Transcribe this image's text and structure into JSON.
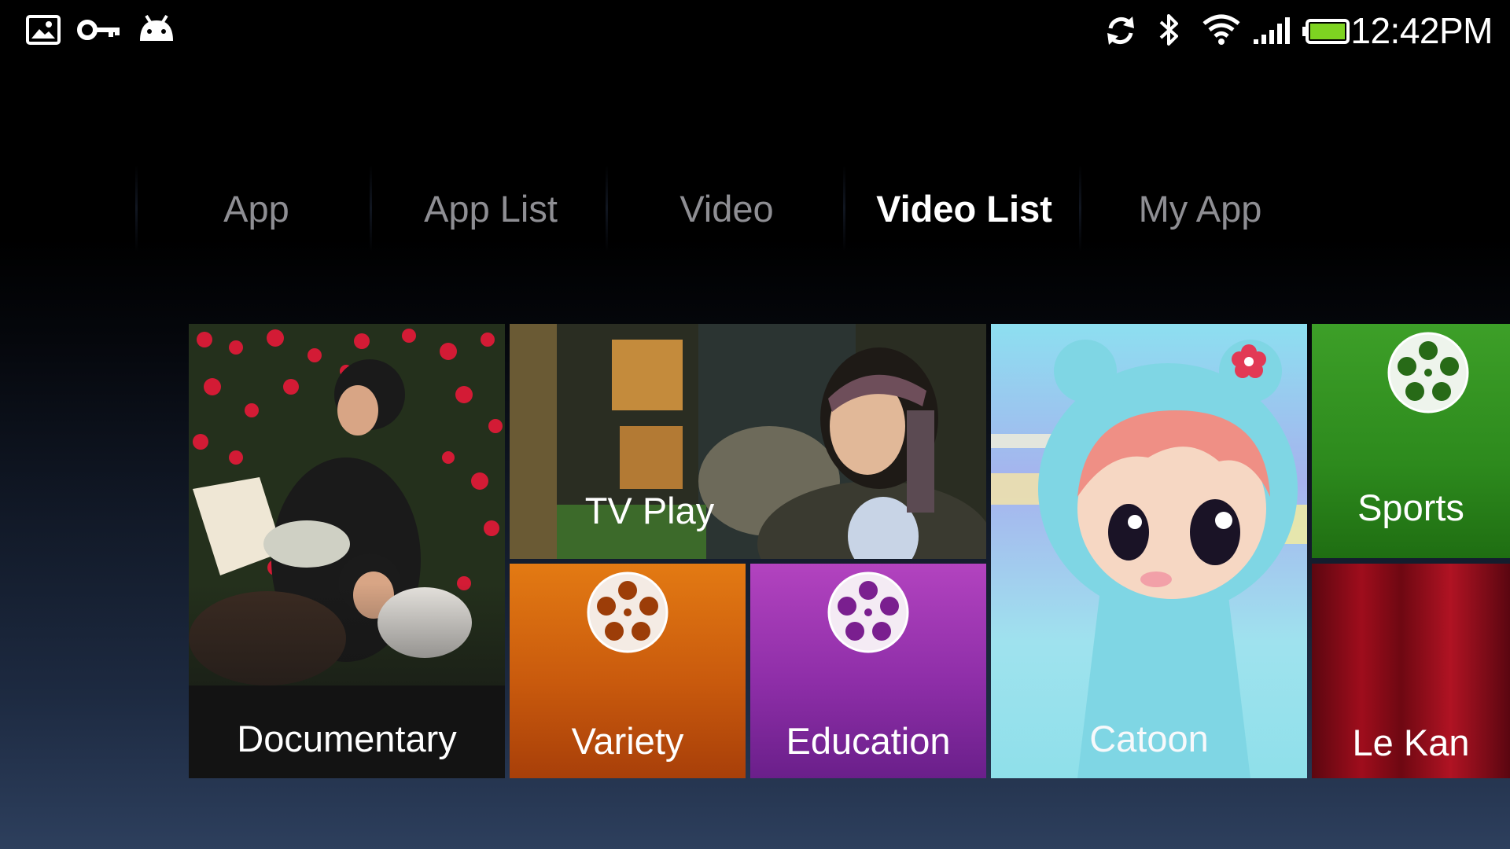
{
  "status_bar": {
    "left_icons": [
      "gallery-icon",
      "vpn-key-icon",
      "android-debug-icon"
    ],
    "right_icons": [
      "sync-icon",
      "bluetooth-icon",
      "wifi-icon",
      "signal-icon",
      "battery-icon"
    ],
    "time": "12:42PM",
    "battery_color": "#7ed321"
  },
  "tabs": [
    {
      "label": "App",
      "active": false
    },
    {
      "label": "App List",
      "active": false
    },
    {
      "label": "Video",
      "active": false
    },
    {
      "label": "Video List",
      "active": true
    },
    {
      "label": "My App",
      "active": false
    }
  ],
  "tiles": {
    "documentary": {
      "label": "Documentary",
      "icon": "photo-thumbnail"
    },
    "tvplay": {
      "label": "TV Play",
      "icon": "photo-thumbnail"
    },
    "variety": {
      "label": "Variety",
      "icon": "film-reel-icon",
      "color": "#d3650f"
    },
    "education": {
      "label": "Education",
      "icon": "film-reel-icon",
      "color": "#9a34b0"
    },
    "catoon": {
      "label": "Catoon",
      "icon": "cartoon-thumbnail",
      "color": "#9fe2ee"
    },
    "sports": {
      "label": "Sports",
      "icon": "film-reel-icon",
      "color": "#2f8d1f"
    },
    "lekan": {
      "label": "Le Kan",
      "icon": "curtain-thumbnail",
      "color": "#9f0d1c"
    }
  }
}
